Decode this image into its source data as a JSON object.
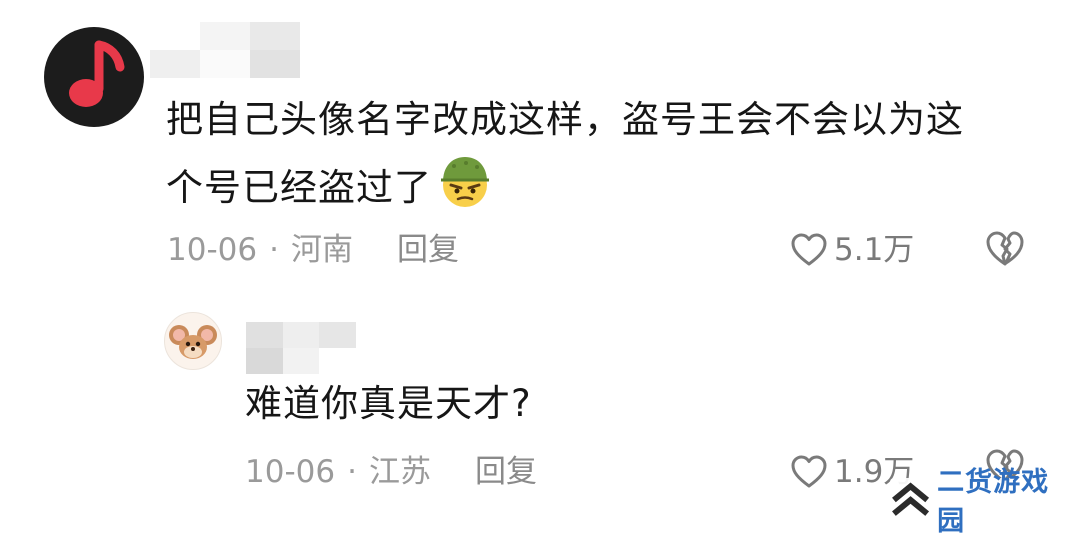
{
  "comment": {
    "text_line1": "把自己头像名字改成这样，盗号王会不会以为这",
    "text_line2": "个号已经盗过了",
    "emoji": "cool-soldier-emoji",
    "date": "10-06",
    "separator": "·",
    "location": "河南",
    "reply_label": "回复",
    "like_count": "5.1万"
  },
  "reply": {
    "text": "难道你真是天才?",
    "date": "10-06",
    "separator": "·",
    "location": "江苏",
    "reply_label": "回复",
    "like_count": "1.9万"
  },
  "watermark": {
    "text": "二货游戏园"
  },
  "colors": {
    "text_primary": "#161616",
    "text_meta": "#9a9a9a",
    "avatar_bg": "#1c1c1c",
    "music_note": "#e8394a",
    "watermark_blue": "#2f6fc0"
  },
  "icons": {
    "main_avatar": "music-note-icon",
    "reply_avatar": "cartoon-mouse-avatar",
    "like": "heart-outline-icon",
    "dislike": "broken-heart-icon",
    "watermark_logo": "double-chevron-up-icon"
  }
}
